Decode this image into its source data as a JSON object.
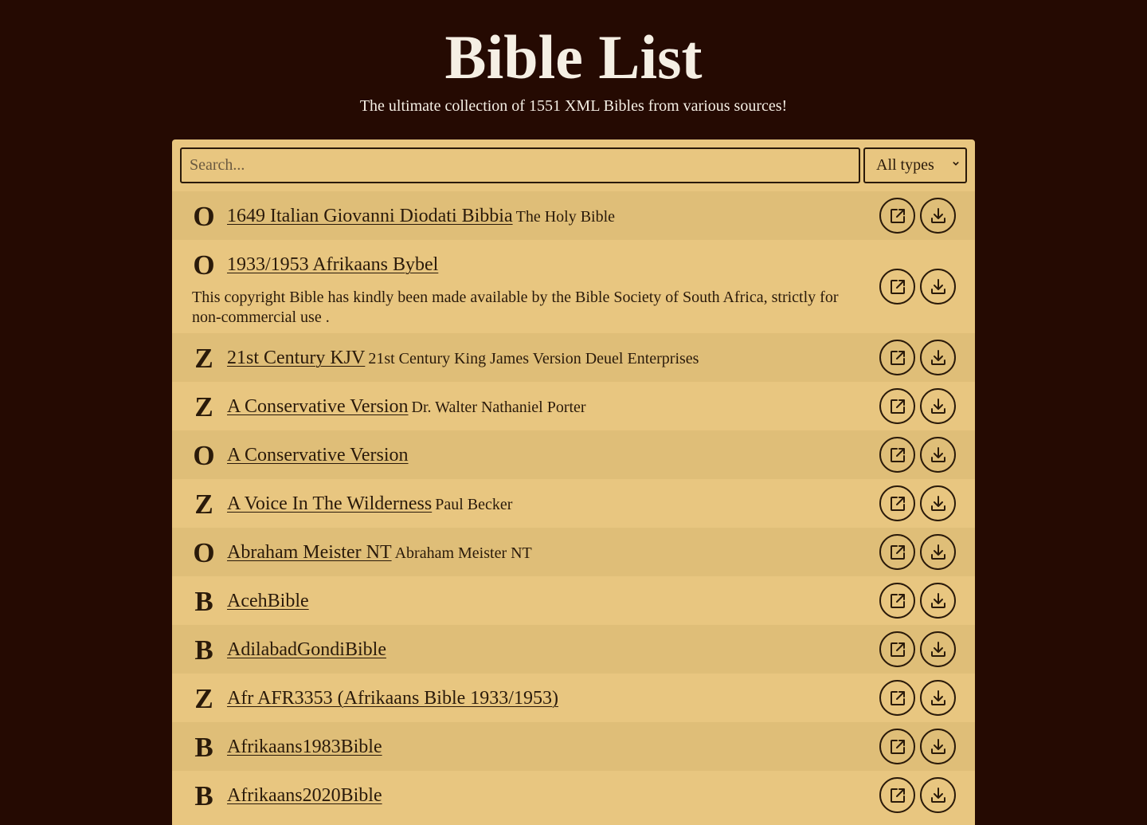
{
  "header": {
    "title": "Bible List",
    "subtitle": "The ultimate collection of 1551 XML Bibles from various sources!"
  },
  "search": {
    "placeholder": "Search...",
    "value": ""
  },
  "type_filter": {
    "selected": "All types"
  },
  "bibles": [
    {
      "type": "O",
      "title": "1649 Italian Giovanni Diodati Bibbia",
      "desc": "The Holy Bible",
      "note": ""
    },
    {
      "type": "O",
      "title": "1933/1953 Afrikaans Bybel",
      "desc": "",
      "note": "This copyright Bible has kindly been made available by the Bible Society of South Africa, strictly for non-commercial use ."
    },
    {
      "type": "Z",
      "title": "21st Century KJV",
      "desc": "21st Century King James Version Deuel Enterprises",
      "note": ""
    },
    {
      "type": "Z",
      "title": "A Conservative Version",
      "desc": "Dr. Walter Nathaniel Porter",
      "note": ""
    },
    {
      "type": "O",
      "title": "A Conservative Version",
      "desc": "",
      "note": ""
    },
    {
      "type": "Z",
      "title": "A Voice In The Wilderness",
      "desc": "Paul Becker",
      "note": ""
    },
    {
      "type": "O",
      "title": "Abraham Meister NT",
      "desc": "Abraham Meister NT",
      "note": ""
    },
    {
      "type": "B",
      "title": "AcehBible",
      "desc": "",
      "note": ""
    },
    {
      "type": "B",
      "title": "AdilabadGondiBible",
      "desc": "",
      "note": ""
    },
    {
      "type": "Z",
      "title": "Afr AFR3353 (Afrikaans Bible 1933/1953)",
      "desc": "",
      "note": ""
    },
    {
      "type": "B",
      "title": "Afrikaans1983Bible",
      "desc": "",
      "note": ""
    },
    {
      "type": "B",
      "title": "Afrikaans2020Bible",
      "desc": "",
      "note": ""
    }
  ],
  "icons": {
    "open": "external-link-icon",
    "download": "download-icon"
  },
  "colors": {
    "background": "#250a02",
    "panel": "#e8c680",
    "panel_alt_row": "#dfbe78",
    "text": "#2a1a0a",
    "title_text": "#f5efe4"
  }
}
